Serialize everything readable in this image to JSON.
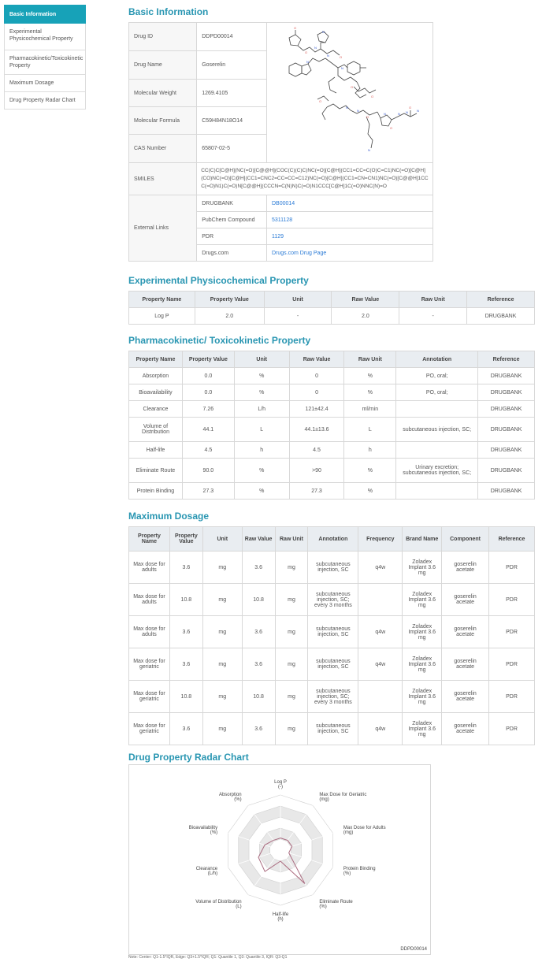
{
  "sidebar": {
    "items": [
      {
        "label": "Basic Information"
      },
      {
        "label": "Experimental Physicochemical Property"
      },
      {
        "label": "Pharmacokinetic/Toxicokinetic Property"
      },
      {
        "label": "Maximum Dosage"
      },
      {
        "label": "Drug Property Radar Chart"
      }
    ]
  },
  "basic": {
    "title": "Basic Information",
    "rows": [
      {
        "label": "Drug ID",
        "value": "DDPD00014"
      },
      {
        "label": "Drug Name",
        "value": "Goserelin"
      },
      {
        "label": "Molecular Weight",
        "value": "1269.4105"
      },
      {
        "label": "Molecular Formula",
        "value": "C59H84N18O14"
      },
      {
        "label": "CAS Number",
        "value": "65807-02-5"
      }
    ],
    "smiles_label": "SMILES",
    "smiles": "CC(C)C[C@H](NC(=O)[C@@H](COC(C)(C)C)NC(=O)[C@H](CC1=CC=C(O)C=C1)NC(=O)[C@H](CO)NC(=O)[C@H](CC1=CNC2=CC=CC=C12)NC(=O)[C@H](CC1=CN=CN1)NC(=O)[C@@H]1CCC(=O)N1)C(=O)N[C@@H](CCCN=C(N)N)C(=O)N1CCC[C@H]1C(=O)NNC(N)=O",
    "links_label": "External Links",
    "links": [
      {
        "name": "DRUGBANK",
        "text": "DB00014"
      },
      {
        "name": "PubChem Compound",
        "text": "5311128"
      },
      {
        "name": "PDR",
        "text": "1129"
      },
      {
        "name": "Drugs.com",
        "text": "Drugs.com Drug Page"
      }
    ]
  },
  "exp": {
    "title": "Experimental Physicochemical Property",
    "headers": [
      "Property Name",
      "Property Value",
      "Unit",
      "Raw Value",
      "Raw Unit",
      "Reference"
    ],
    "rows": [
      [
        "Log P",
        "2.0",
        "-",
        "2.0",
        "-",
        "DRUGBANK"
      ]
    ]
  },
  "pk": {
    "title": "Pharmacokinetic/ Toxicokinetic Property",
    "headers": [
      "Property Name",
      "Property Value",
      "Unit",
      "Raw Value",
      "Raw Unit",
      "Annotation",
      "Reference"
    ],
    "rows": [
      [
        "Absorption",
        "0.0",
        "%",
        "0",
        "%",
        "PO, oral;",
        "DRUGBANK"
      ],
      [
        "Bioavailability",
        "0.0",
        "%",
        "0",
        "%",
        "PO, oral;",
        "DRUGBANK"
      ],
      [
        "Clearance",
        "7.26",
        "L/h",
        "121±42.4",
        "ml/min",
        "",
        "DRUGBANK"
      ],
      [
        "Volume of Distribution",
        "44.1",
        "L",
        "44.1±13.6",
        "L",
        "subcutaneous injection, SC;",
        "DRUGBANK"
      ],
      [
        "Half-life",
        "4.5",
        "h",
        "4.5",
        "h",
        "",
        "DRUGBANK"
      ],
      [
        "Eliminate Route",
        "90.0",
        "%",
        ">90",
        "%",
        "Urinary excretion; subcutaneous injection, SC;",
        "DRUGBANK"
      ],
      [
        "Protein Binding",
        "27.3",
        "%",
        "27.3",
        "%",
        "",
        "DRUGBANK"
      ]
    ]
  },
  "dose": {
    "title": "Maximum Dosage",
    "headers": [
      "Property Name",
      "Property Value",
      "Unit",
      "Raw Value",
      "Raw Unit",
      "Annotation",
      "Frequency",
      "Brand Name",
      "Component",
      "Reference"
    ],
    "rows": [
      [
        "Max dose for adults",
        "3.6",
        "mg",
        "3.6",
        "mg",
        "subcutaneous injection, SC",
        "q4w",
        "Zoladex Implant 3.6 mg",
        "goserelin acetate",
        "PDR"
      ],
      [
        "Max dose for adults",
        "10.8",
        "mg",
        "10.8",
        "mg",
        "subcutaneous injection, SC; every 3 months",
        "",
        "Zoladex Implant 3.6 mg",
        "goserelin acetate",
        "PDR"
      ],
      [
        "Max dose for adults",
        "3.6",
        "mg",
        "3.6",
        "mg",
        "subcutaneous injection, SC",
        "q4w",
        "Zoladex Implant 3.6 mg",
        "goserelin acetate",
        "PDR"
      ],
      [
        "Max dose for geriatric",
        "3.6",
        "mg",
        "3.6",
        "mg",
        "subcutaneous injection, SC",
        "q4w",
        "Zoladex Implant 3.6 mg",
        "goserelin acetate",
        "PDR"
      ],
      [
        "Max dose for geriatric",
        "10.8",
        "mg",
        "10.8",
        "mg",
        "subcutaneous injection, SC; every 3 months",
        "",
        "Zoladex Implant 3.6 mg",
        "goserelin acetate",
        "PDR"
      ],
      [
        "Max dose for geriatric",
        "3.6",
        "mg",
        "3.6",
        "mg",
        "subcutaneous injection, SC",
        "q4w",
        "Zoladex Implant 3.6 mg",
        "goserelin acetate",
        "PDR"
      ]
    ]
  },
  "radar": {
    "title": "Drug Property Radar Chart",
    "drug_id": "DDPD00014",
    "note": "Note: Center: Q1-1.5*IQR, Edge: Q3+1.5*IQR; Q1: Quantile 1, Q3: Quantile 3, IQR: Q3-Q1",
    "axes": [
      {
        "name": "Log P",
        "unit": "(-)",
        "r": 0.22
      },
      {
        "name": "Max Dose for Geriatric",
        "unit": "(mg)",
        "r": 0.22
      },
      {
        "name": "Max Dose for Adults",
        "unit": "(mg)",
        "r": 0.22
      },
      {
        "name": "Protein Binding",
        "unit": "(%)",
        "r": 0.16
      },
      {
        "name": "Eliminate Route",
        "unit": "(%)",
        "r": 0.75
      },
      {
        "name": "Half-life",
        "unit": "(h)",
        "r": 0.2
      },
      {
        "name": "Volume of Distribution",
        "unit": "(L)",
        "r": 0.48
      },
      {
        "name": "Clearance",
        "unit": "(L/h)",
        "r": 0.42
      },
      {
        "name": "Bioavailability",
        "unit": "(%)",
        "r": 0.3
      },
      {
        "name": "Absorption",
        "unit": "(%)",
        "r": 0.22
      }
    ]
  }
}
